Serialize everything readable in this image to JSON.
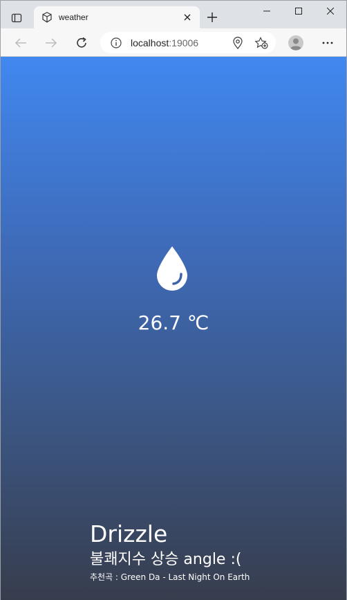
{
  "browser": {
    "tab_title": "weather",
    "url_host": "localhost",
    "url_port": ":19006"
  },
  "page": {
    "temperature": "26.7 ℃",
    "condition": "Drizzle",
    "mood": "불쾌지수 상승 angle :(",
    "song": "추천곡 : Green Da - Last Night On Earth"
  },
  "colors": {
    "gradient_top": "#4188f0",
    "gradient_bottom": "#373d4d",
    "text": "#ffffff"
  },
  "icons": {
    "weather": "raindrop-icon"
  }
}
